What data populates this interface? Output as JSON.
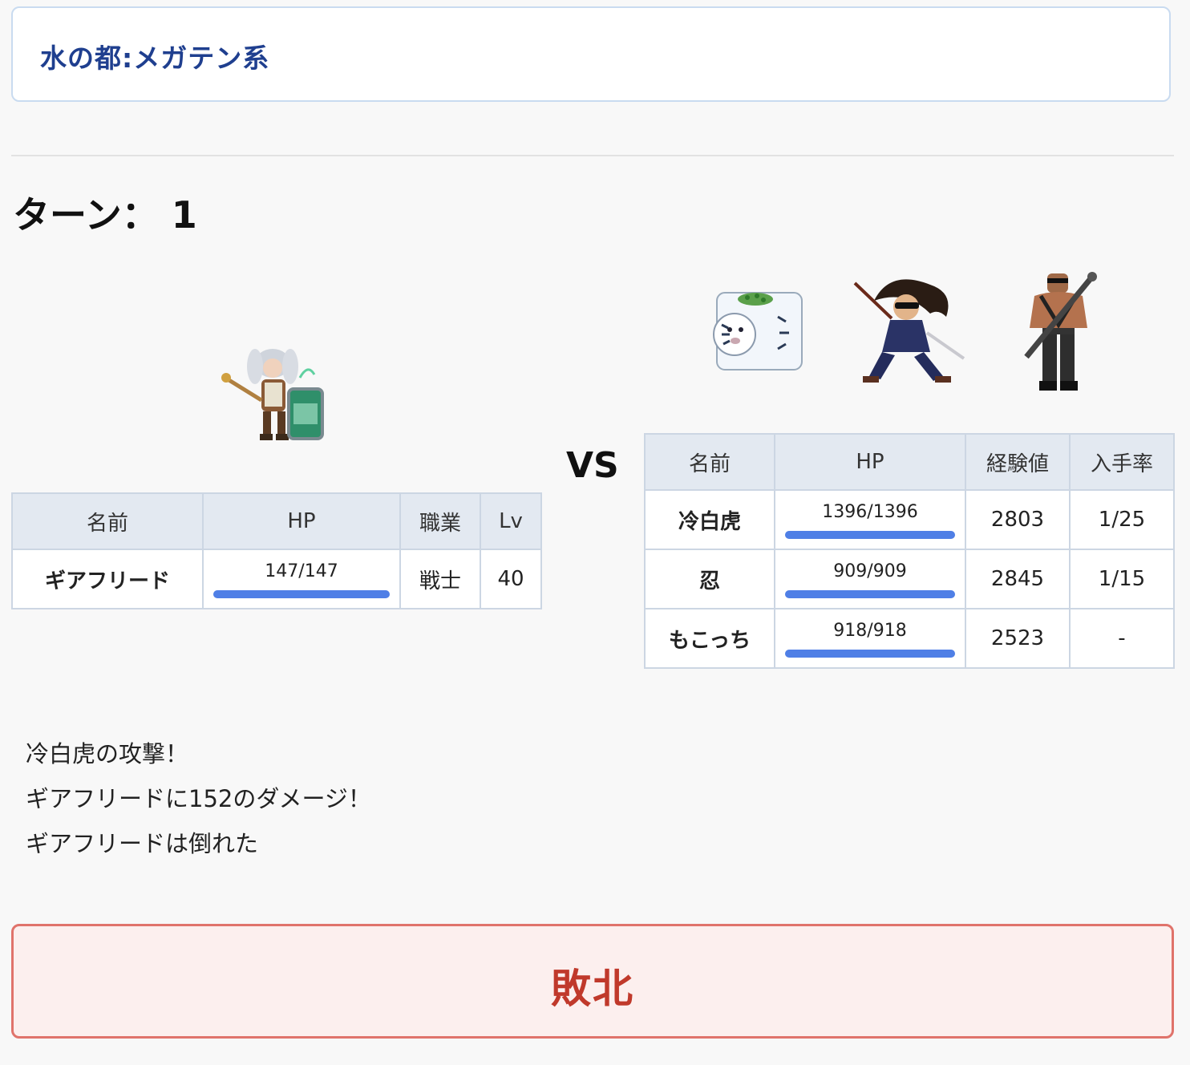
{
  "header": {
    "title": "水の都:メガテン系"
  },
  "turn": {
    "label": "ターン： 1"
  },
  "vs": "VS",
  "player_table": {
    "headers": {
      "name": "名前",
      "hp": "HP",
      "job": "職業",
      "lv": "Lv"
    },
    "rows": [
      {
        "name": "ギアフリード",
        "hp_text": "147/147",
        "hp_fraction": 1.0,
        "job": "戦士",
        "lv": "40"
      }
    ]
  },
  "enemy_table": {
    "headers": {
      "name": "名前",
      "hp": "HP",
      "exp": "経験値",
      "rate": "入手率"
    },
    "rows": [
      {
        "name": "冷白虎",
        "hp_text": "1396/1396",
        "hp_fraction": 1.0,
        "exp": "2803",
        "rate": "1/25"
      },
      {
        "name": "忍",
        "hp_text": "909/909",
        "hp_fraction": 1.0,
        "exp": "2845",
        "rate": "1/15"
      },
      {
        "name": "もこっち",
        "hp_text": "918/918",
        "hp_fraction": 1.0,
        "exp": "2523",
        "rate": "-"
      }
    ]
  },
  "sprites": {
    "player": "armored-warrior-girl-with-hammer",
    "enemies": [
      "white-tiger-tofu-block",
      "sunglasses-ninja-in-suit",
      "muscular-soldier-with-spiked-club"
    ]
  },
  "log": {
    "lines": [
      "冷白虎の攻撃！",
      "ギアフリードに152のダメージ！",
      "ギアフリードは倒れた"
    ]
  },
  "result": {
    "label": "敗北"
  },
  "colors": {
    "hp_bar": "#4f7fe6",
    "title": "#1f3f8f",
    "defeat": "#c0392b"
  }
}
